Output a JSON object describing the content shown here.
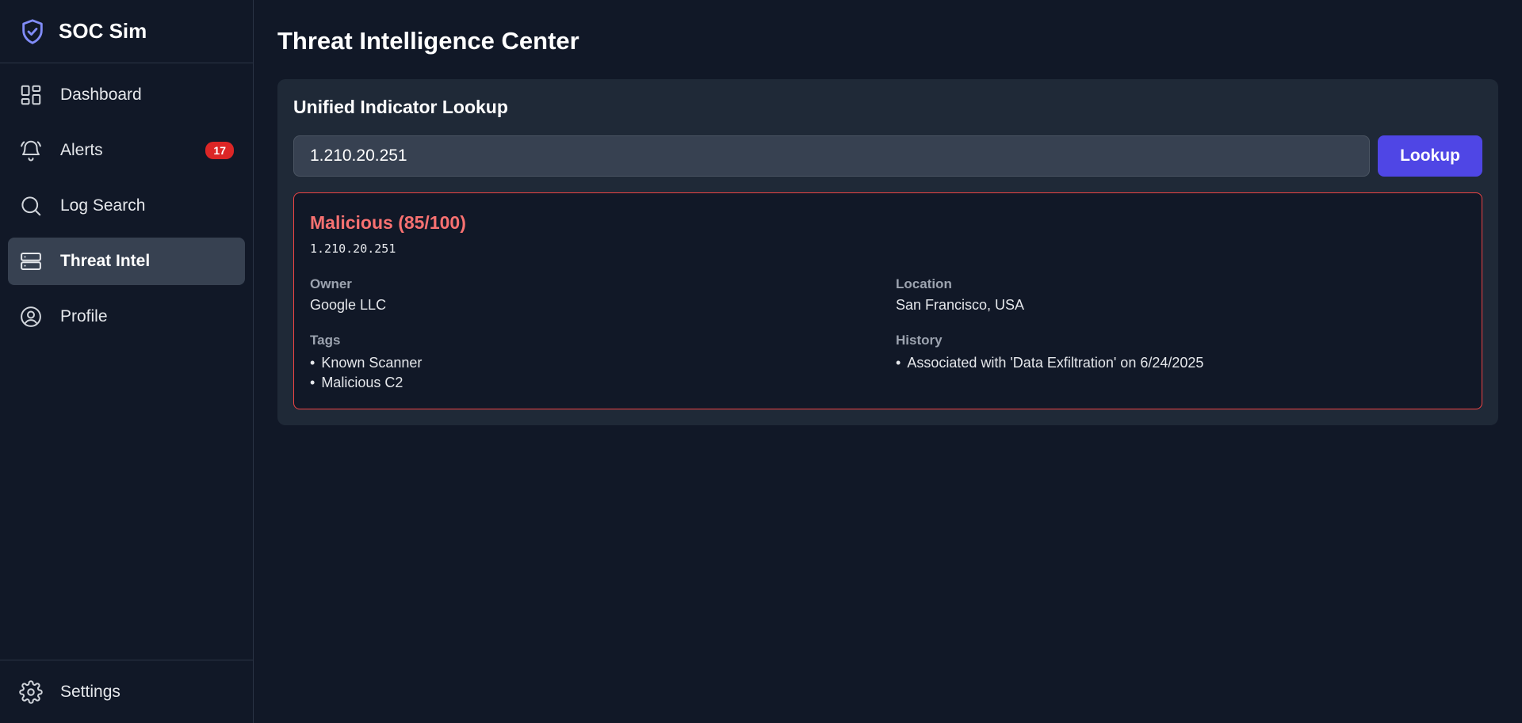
{
  "brand": {
    "name": "SOC Sim"
  },
  "sidebar": {
    "items": [
      {
        "label": "Dashboard",
        "icon": "dashboard-icon"
      },
      {
        "label": "Alerts",
        "icon": "bell-icon",
        "badge": "17"
      },
      {
        "label": "Log Search",
        "icon": "search-icon"
      },
      {
        "label": "Threat Intel",
        "icon": "server-icon",
        "active": true
      },
      {
        "label": "Profile",
        "icon": "user-circle-icon"
      }
    ],
    "footer": {
      "label": "Settings",
      "icon": "gear-icon"
    }
  },
  "main": {
    "title": "Threat Intelligence Center",
    "panel": {
      "title": "Unified Indicator Lookup",
      "search": {
        "value": "1.210.20.251"
      },
      "lookup_label": "Lookup",
      "result": {
        "verdict": "Malicious (85/100)",
        "indicator": "1.210.20.251",
        "owner_label": "Owner",
        "owner": "Google LLC",
        "location_label": "Location",
        "location": "San Francisco, USA",
        "tags_label": "Tags",
        "tags": [
          "Known Scanner",
          "Malicious C2"
        ],
        "history_label": "History",
        "history": [
          "Associated with 'Data Exfiltration' on 6/24/2025"
        ]
      }
    }
  },
  "colors": {
    "background": "#111827",
    "panel": "#1f2937",
    "accent": "#4f46e5",
    "danger": "#ef4444",
    "badge": "#dc2626"
  }
}
